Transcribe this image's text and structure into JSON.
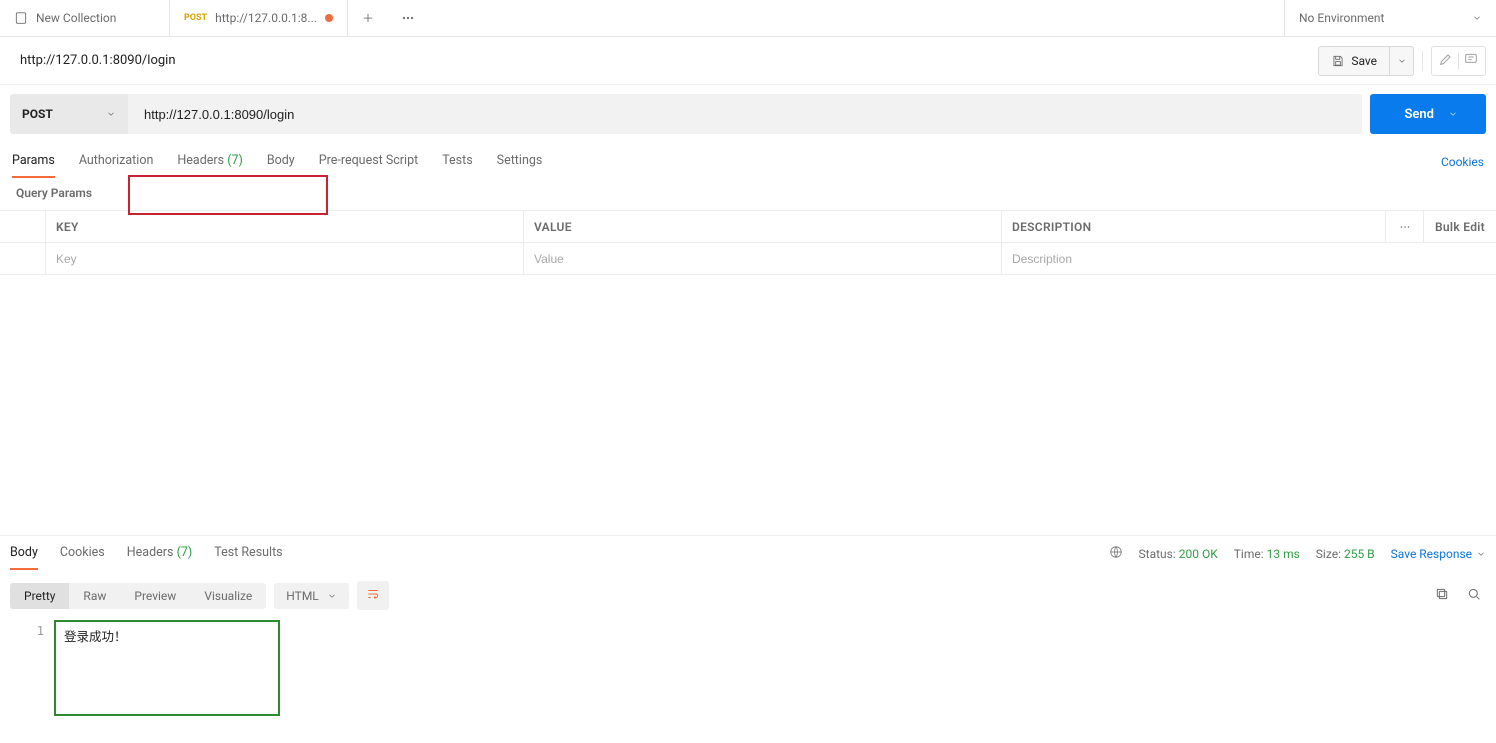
{
  "tabs": {
    "collection": {
      "label": "New Collection"
    },
    "request": {
      "method": "POST",
      "label": "http://127.0.0.1:8..."
    }
  },
  "env": {
    "label": "No Environment"
  },
  "request": {
    "name": "http://127.0.0.1:8090/login",
    "method": "POST",
    "url": "http://127.0.0.1:8090/login",
    "save_label": "Save",
    "send_label": "Send"
  },
  "subtabs": {
    "params": "Params",
    "authorization": "Authorization",
    "headers": "Headers",
    "headers_count": "(7)",
    "body": "Body",
    "prerequest": "Pre-request Script",
    "tests": "Tests",
    "settings": "Settings",
    "cookies": "Cookies"
  },
  "query_params_label": "Query Params",
  "kv": {
    "headers": {
      "key": "KEY",
      "value": "VALUE",
      "description": "DESCRIPTION",
      "bulk": "Bulk Edit"
    },
    "placeholders": {
      "key": "Key",
      "value": "Value",
      "description": "Description"
    }
  },
  "response_tabs": {
    "body": "Body",
    "cookies": "Cookies",
    "headers": "Headers",
    "headers_count": "(7)",
    "test_results": "Test Results"
  },
  "response_meta": {
    "status_label": "Status:",
    "status_value": "200 OK",
    "time_label": "Time:",
    "time_value": "13 ms",
    "size_label": "Size:",
    "size_value": "255 B",
    "save_response": "Save Response"
  },
  "response_toolbar": {
    "pretty": "Pretty",
    "raw": "Raw",
    "preview": "Preview",
    "visualize": "Visualize",
    "lang": "HTML"
  },
  "response_body": {
    "line_number": "1",
    "content": "登录成功！"
  }
}
